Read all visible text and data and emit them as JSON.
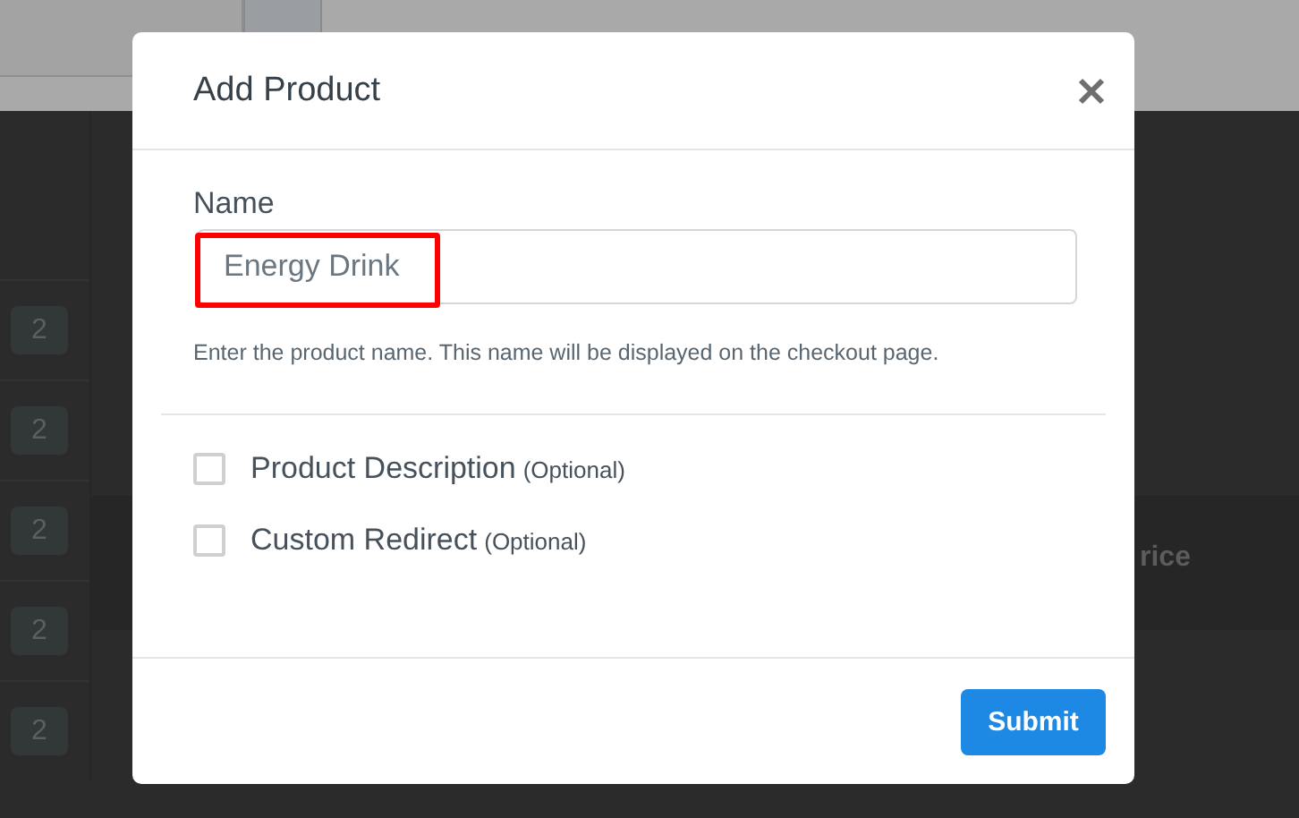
{
  "background": {
    "badges": [
      "2",
      "2",
      "2",
      "2",
      "2"
    ],
    "column_header": "rice"
  },
  "modal": {
    "title": "Add Product",
    "name_label": "Name",
    "name_value": "Energy Drink",
    "name_highlighted": true,
    "help_text": "Enter the product name. This name will be displayed on the checkout page.",
    "options": [
      {
        "label": "Product Description",
        "hint": "(Optional)",
        "checked": false
      },
      {
        "label": "Custom Redirect",
        "hint": "(Optional)",
        "checked": false
      }
    ],
    "submit": "Submit"
  }
}
